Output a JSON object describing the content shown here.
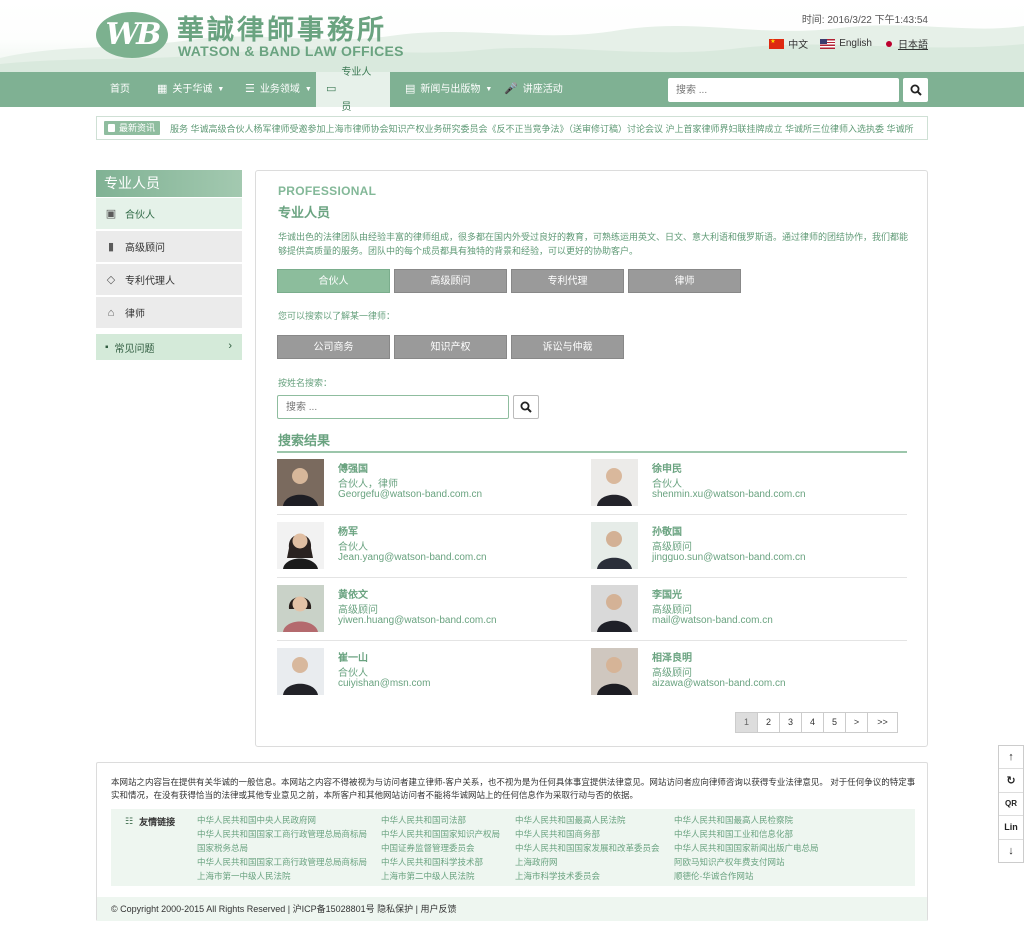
{
  "header": {
    "logo_mark": "WB",
    "logo_cn": "華誠律師事務所",
    "logo_en": "WATSON & BAND LAW OFFICES",
    "clock": "时间: 2016/3/22 下午1:43:54",
    "languages": [
      {
        "label": "中文",
        "flag": "flag-cn"
      },
      {
        "label": "English",
        "flag": "flag-us"
      },
      {
        "label": "日本語",
        "flag": "flag-jp"
      }
    ]
  },
  "nav": {
    "items": [
      {
        "label": "首页",
        "icon": ""
      },
      {
        "label": "关于华诚",
        "icon": "grid-icon",
        "dropdown": true
      },
      {
        "label": "业务领域",
        "icon": "list-icon",
        "dropdown": true
      },
      {
        "label": "专业人员",
        "icon": "card-icon",
        "active": true
      },
      {
        "label": "新闻与出版物",
        "icon": "newspaper-icon",
        "dropdown": true
      },
      {
        "label": "讲座活动",
        "icon": "microphone-icon"
      }
    ],
    "search_placeholder": "搜索 ..."
  },
  "ticker": {
    "badge": "最新资讯",
    "text": "服务       华诚高级合伙人杨军律师受邀参加上海市律师协会知识产权业务研究委员会《反不正当竞争法》（送审修订稿）讨论会议       沪上首家律师界妇联挂牌成立 华诚所三位律师入选执委       华诚所"
  },
  "sidebar": {
    "title": "专业人员",
    "items": [
      {
        "label": "合伙人",
        "icon": "briefcase-icon",
        "active": true
      },
      {
        "label": "高级顾问",
        "icon": "book-icon"
      },
      {
        "label": "专利代理人",
        "icon": "diamond-icon"
      },
      {
        "label": "律师",
        "icon": "building-icon"
      }
    ],
    "faq": "常见问题"
  },
  "main": {
    "title_en": "PROFESSIONAL",
    "title_cn": "专业人员",
    "intro": "华诚出色的法律团队由经验丰富的律师组成，很多都在国内外受过良好的教育，可熟练运用英文、日文、意大利语和俄罗斯语。通过律师的团结协作，我们都能够提供高质量的服务。团队中的每个成员都具有独特的背景和经验，可以更好的协助客户。",
    "role_buttons": [
      "合伙人",
      "高级顾问",
      "专利代理",
      "律师"
    ],
    "hint": "您可以搜索以了解某一律师：",
    "practice_buttons": [
      "公司商务",
      "知识产权",
      "诉讼与仲裁"
    ],
    "name_search_label": "按姓名搜索：",
    "name_search_placeholder": "搜索 ...",
    "results_title": "搜索结果",
    "people": [
      {
        "name": "傅强国",
        "title": "合伙人，律师",
        "email": "Georgefu@watson-band.com.cn"
      },
      {
        "name": "徐申民",
        "title": "合伙人",
        "email": "shenmin.xu@watson-band.com.cn"
      },
      {
        "name": "杨军",
        "title": "合伙人",
        "email": "Jean.yang@watson-band.com.cn"
      },
      {
        "name": "孙敬国",
        "title": "高级顾问",
        "email": "jingguo.sun@watson-band.com.cn"
      },
      {
        "name": "黄依文",
        "title": "高级顾问",
        "email": "yiwen.huang@watson-band.com.cn"
      },
      {
        "name": "李国光",
        "title": "高级顾问",
        "email": "mail@watson-band.com.cn"
      },
      {
        "name": "崔一山",
        "title": "合伙人",
        "email": "cuiyishan@msn.com"
      },
      {
        "name": "相泽良明",
        "title": "高级顾问",
        "email": "aizawa@watson-band.com.cn"
      }
    ],
    "pagination": [
      "1",
      "2",
      "3",
      "4",
      "5",
      ">",
      ">>"
    ],
    "current_page": "1"
  },
  "tools": [
    "↑",
    "↻",
    "QR",
    "Lin",
    "↓"
  ],
  "footer": {
    "disclaimer": "本网站之内容旨在提供有关华诚的一般信息。本网站之内容不得被视为与访问者建立律师-客户关系，也不视为是为任何具体事宜提供法律意见。网站访问者应向律师咨询以获得专业法律意见。 对于任何争议的特定事实和情况，在没有获得恰当的法律或其他专业意见之前，本所客户和其他网站访问者不能将华诚网站上的任何信息作为采取行动与否的依据。",
    "links_label": "友情链接",
    "links": [
      [
        "中华人民共和国中央人民政府网",
        "中华人民共和国国家工商行政管理总局商标局",
        "国家税务总局",
        "中华人民共和国国家工商行政管理总局商标局",
        "上海市第一中级人民法院"
      ],
      [
        "中华人民共和国司法部",
        "中华人民共和国国家知识产权局",
        "中国证券监督管理委员会",
        "中华人民共和国科学技术部",
        "上海市第二中级人民法院"
      ],
      [
        "中华人民共和国最高人民法院",
        "中华人民共和国商务部",
        "中华人民共和国国家发展和改革委员会",
        "上海政府网",
        "上海市科学技术委员会"
      ],
      [
        "中华人民共和国最高人民检察院",
        "中华人民共和国工业和信息化部",
        "中华人民共和国国家新闻出版广电总局",
        "阿欧马知识产权年费支付网站",
        "顺德伦-华诚合作网站"
      ]
    ],
    "copyright": "© Copyright 2000-2015 All Rights Reserved | 沪ICP备15028801号 隐私保护 | 用户反馈"
  },
  "colors": {
    "brand": "#7fb193",
    "brand_text": "#6aa380",
    "button_gray": "#9a9a9a"
  }
}
